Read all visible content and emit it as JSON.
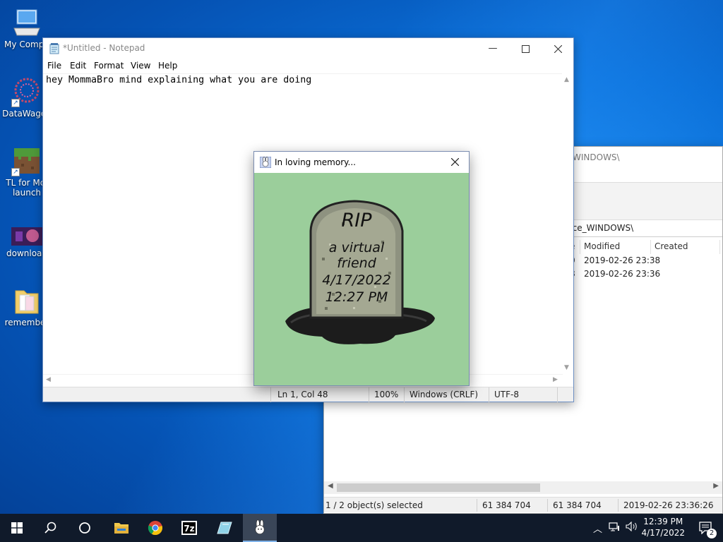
{
  "desktop": {
    "icons": [
      {
        "label": "My Compu",
        "icon": "computer-icon"
      },
      {
        "label": "DataWagon",
        "icon": "datawagon-icon"
      },
      {
        "label": "TL for Mc-launch",
        "icon": "minecraft-grass-block-icon"
      },
      {
        "label": "download",
        "icon": "download-image-icon"
      },
      {
        "label": "remember",
        "icon": "folder-icon"
      }
    ]
  },
  "explorer": {
    "path_top": "WINDOWS\\",
    "address": "nce_WINDOWS\\",
    "columns": {
      "modified": "Modified",
      "created": "Created"
    },
    "rows": [
      {
        "modified": "2019-02-26 23:38"
      },
      {
        "modified": "2019-02-26 23:36"
      }
    ],
    "status": {
      "selected": "1 / 2 object(s) selected",
      "size1": "61 384 704",
      "size2": "61 384 704",
      "date": "2019-02-26 23:36:26"
    }
  },
  "notepad": {
    "title": "*Untitled - Notepad",
    "menu": [
      "File",
      "Edit",
      "Format",
      "View",
      "Help"
    ],
    "content": "hey MommaBro mind explaining what you are doing",
    "status": {
      "position": "Ln 1, Col 48",
      "zoom": "100%",
      "line_ending": "Windows (CRLF)",
      "encoding": "UTF-8"
    }
  },
  "dialog": {
    "title": "In loving memory...",
    "tombstone": {
      "line1": "RIP",
      "line2": "a virtual",
      "line3": "friend",
      "line4": "4/17/2022",
      "line5": "12:27 PM"
    },
    "background_color": "#9bce9b"
  },
  "taskbar": {
    "buttons": [
      "windows-start-icon",
      "search-icon",
      "task-view-icon",
      "file-explorer-icon",
      "chrome-icon",
      "7zip-icon",
      "app-icon",
      "bunny-app-icon"
    ],
    "time": "12:39 PM",
    "date": "4/17/2022",
    "notifications": "2"
  }
}
